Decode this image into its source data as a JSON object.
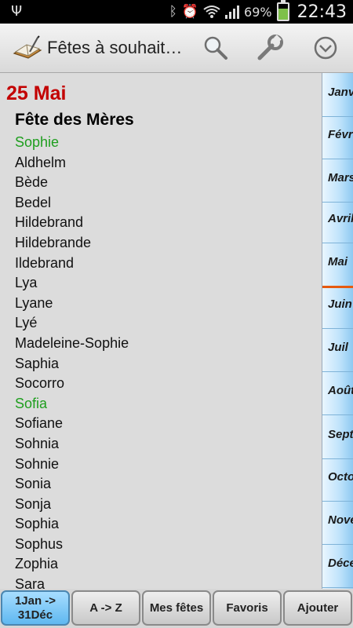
{
  "status_bar": {
    "battery_percent": "69%",
    "time": "22:43",
    "battery_level": 0.69,
    "icons": [
      "usb-icon",
      "bluetooth-icon",
      "alarm-icon",
      "wifi-icon",
      "signal-icon",
      "battery-charging-icon"
    ]
  },
  "action_bar": {
    "title": "Fêtes à souhait…",
    "icons": [
      "app-book-icon",
      "search-icon",
      "wrench-icon",
      "overflow-menu-icon"
    ]
  },
  "day": {
    "date": "25 Mai",
    "fete": "Fête des Mères",
    "names": [
      {
        "name": "Sophie",
        "highlight": true
      },
      {
        "name": "Aldhelm",
        "highlight": false
      },
      {
        "name": "Bède",
        "highlight": false
      },
      {
        "name": "Bedel",
        "highlight": false
      },
      {
        "name": "Hildebrand",
        "highlight": false
      },
      {
        "name": "Hildebrande",
        "highlight": false
      },
      {
        "name": "Ildebrand",
        "highlight": false
      },
      {
        "name": "Lya",
        "highlight": false
      },
      {
        "name": "Lyane",
        "highlight": false
      },
      {
        "name": "Lyé",
        "highlight": false
      },
      {
        "name": "Madeleine-Sophie",
        "highlight": false
      },
      {
        "name": "Saphia",
        "highlight": false
      },
      {
        "name": "Socorro",
        "highlight": false
      },
      {
        "name": "Sofia",
        "highlight": true
      },
      {
        "name": "Sofiane",
        "highlight": false
      },
      {
        "name": "Sohnia",
        "highlight": false
      },
      {
        "name": "Sohnie",
        "highlight": false
      },
      {
        "name": "Sonia",
        "highlight": false
      },
      {
        "name": "Sonja",
        "highlight": false
      },
      {
        "name": "Sophia",
        "highlight": false
      },
      {
        "name": "Sophus",
        "highlight": false
      },
      {
        "name": "Zophia",
        "highlight": false
      },
      {
        "name": "Sara",
        "highlight": false
      }
    ]
  },
  "months": [
    "Janv",
    "Févr",
    "Mars",
    "Avril",
    "Mai",
    "Juin",
    "Juil",
    "Août",
    "Sept",
    "Octo",
    "Nove",
    "Déce"
  ],
  "current_month": "Mai",
  "tabs": [
    {
      "label": "1Jan ->\n31Déc",
      "active": true
    },
    {
      "label": "A -> Z",
      "active": false
    },
    {
      "label": "Mes fêtes",
      "active": false
    },
    {
      "label": "Favoris",
      "active": false
    },
    {
      "label": "Ajouter",
      "active": false
    }
  ],
  "colors": {
    "date_red": "#c30000",
    "highlight_green": "#1e9e1e",
    "active_tab_blue": "#5fb8f0",
    "current_month_marker": "#e65a10"
  }
}
